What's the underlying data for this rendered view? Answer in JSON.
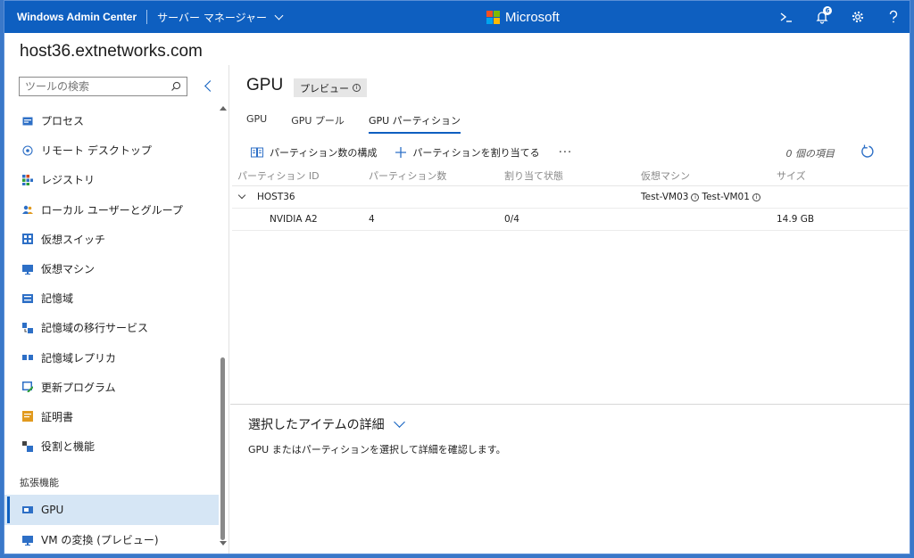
{
  "topbar": {
    "app_title": "Windows Admin Center",
    "server_menu": "サーバー マネージャー",
    "brand": "Microsoft",
    "notification_count": "6"
  },
  "host": "host36.extnetworks.com",
  "sidebar": {
    "search_placeholder": "ツールの検索",
    "items": [
      {
        "label": "プロセス",
        "icon": "process-icon"
      },
      {
        "label": "リモート デスクトップ",
        "icon": "remote-desktop-icon"
      },
      {
        "label": "レジストリ",
        "icon": "registry-icon"
      },
      {
        "label": "ローカル ユーザーとグループ",
        "icon": "users-icon"
      },
      {
        "label": "仮想スイッチ",
        "icon": "virtual-switch-icon"
      },
      {
        "label": "仮想マシン",
        "icon": "virtual-machine-icon"
      },
      {
        "label": "記憶域",
        "icon": "storage-icon"
      },
      {
        "label": "記憶域の移行サービス",
        "icon": "storage-migration-icon"
      },
      {
        "label": "記憶域レプリカ",
        "icon": "storage-replica-icon"
      },
      {
        "label": "更新プログラム",
        "icon": "updates-icon"
      },
      {
        "label": "証明書",
        "icon": "certificate-icon"
      },
      {
        "label": "役割と機能",
        "icon": "roles-icon"
      }
    ],
    "group_label": "拡張機能",
    "extensions": [
      {
        "label": "GPU",
        "icon": "gpu-icon",
        "active": true
      },
      {
        "label": "VM の変換 (プレビュー)",
        "icon": "vm-convert-icon"
      }
    ]
  },
  "main": {
    "title": "GPU",
    "preview_label": "プレビュー",
    "tabs": [
      "GPU",
      "GPU プール",
      "GPU パーティション"
    ],
    "active_tab": 2,
    "toolbar": {
      "configure_label": "パーティション数の構成",
      "assign_label": "パーティションを割り当てる",
      "more_label": "···",
      "item_count": "0 個の項目"
    },
    "columns": [
      "パーティション ID",
      "パーティション数",
      "割り当て状態",
      "仮想マシン",
      "サイズ"
    ],
    "rows": [
      {
        "id": "HOST36",
        "count": "",
        "state": "",
        "vm1": "Test-VM03",
        "vm2": "Test-VM01",
        "size": ""
      },
      {
        "id": "NVIDIA A2",
        "count": "4",
        "state": "0/4",
        "size": "14.9 GB"
      }
    ],
    "details_title": "選択したアイテムの詳細",
    "details_text": "GPU またはパーティションを選択して詳細を確認します。"
  },
  "colors": {
    "accent": "#0e5fc0",
    "active_bg": "#d6e6f5"
  }
}
